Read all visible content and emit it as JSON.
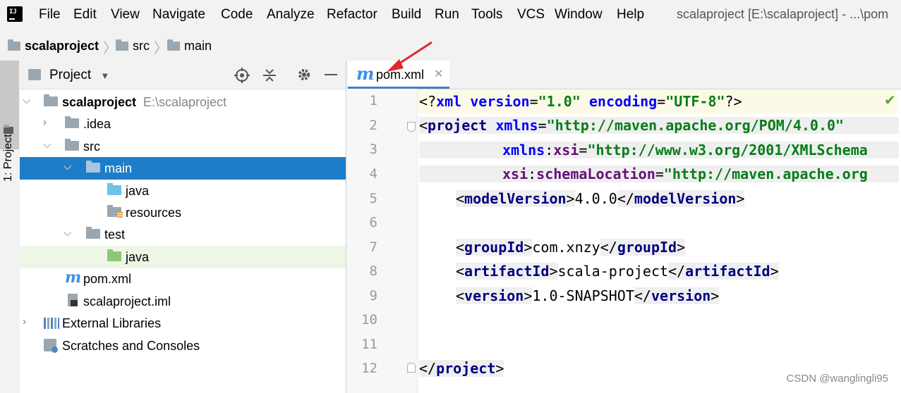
{
  "menu": {
    "items": [
      "File",
      "Edit",
      "View",
      "Navigate",
      "Code",
      "Analyze",
      "Refactor",
      "Build",
      "Run",
      "Tools",
      "VCS",
      "Window",
      "Help"
    ],
    "window_title": "scalaproject [E:\\scalaproject] - ...\\pom"
  },
  "breadcrumb": [
    "scalaproject",
    "src",
    "main"
  ],
  "stripe": {
    "project_label": "1: Project"
  },
  "project_panel": {
    "title": "Project",
    "tree": [
      {
        "label": "scalaproject",
        "path": "E:\\scalaproject",
        "icon": "module-folder-icon",
        "expanded": true
      },
      {
        "label": ".idea",
        "icon": "folder-icon",
        "expanded": false
      },
      {
        "label": "src",
        "icon": "folder-icon",
        "expanded": true
      },
      {
        "label": "main",
        "icon": "folder-icon",
        "expanded": true,
        "selected": true
      },
      {
        "label": "java",
        "icon": "source-root-folder-icon"
      },
      {
        "label": "resources",
        "icon": "resources-folder-icon"
      },
      {
        "label": "test",
        "icon": "folder-icon",
        "expanded": true
      },
      {
        "label": "java",
        "icon": "test-root-folder-icon"
      },
      {
        "label": "pom.xml",
        "icon": "maven-file-icon"
      },
      {
        "label": "scalaproject.iml",
        "icon": "iml-file-icon"
      },
      {
        "label": "External Libraries",
        "icon": "libraries-icon",
        "expanded": false
      },
      {
        "label": "Scratches and Consoles",
        "icon": "scratches-icon"
      }
    ]
  },
  "editor": {
    "tab_label": "pom.xml",
    "line_numbers": [
      "1",
      "2",
      "3",
      "4",
      "5",
      "6",
      "7",
      "8",
      "9",
      "10",
      "11",
      "12"
    ],
    "lines": {
      "l1": {
        "a": "<?",
        "b": "xml ",
        "c": "version",
        "d": "=",
        "e": "\"1.0\"",
        "f": " ",
        "g": "encoding",
        "h": "=",
        "i": "\"UTF-8\"",
        "j": "?>"
      },
      "l2": {
        "a": "<",
        "b": "project ",
        "c": "xmlns",
        "d": "=",
        "e": "\"http://maven.apache.org/POM/4.0.0\""
      },
      "l3": {
        "a": "xmlns",
        "b": ":",
        "c": "xsi",
        "d": "=",
        "e": "\"http://www.w3.org/2001/XMLSchema"
      },
      "l4": {
        "a": "xsi",
        "b": ":",
        "c": "schemaLocation",
        "d": "=",
        "e": "\"http://maven.apache.org"
      },
      "l5": {
        "a": "<",
        "b": "modelVersion",
        "c": ">",
        "d": "4.0.0",
        "e": "</",
        "f": "modelVersion",
        "g": ">"
      },
      "l7": {
        "a": "<",
        "b": "groupId",
        "c": ">",
        "d": "com.xnzy",
        "e": "</",
        "f": "groupId",
        "g": ">"
      },
      "l8": {
        "a": "<",
        "b": "artifactId",
        "c": ">",
        "d": "scala-project",
        "e": "</",
        "f": "artifactId",
        "g": ">"
      },
      "l9": {
        "a": "<",
        "b": "version",
        "c": ">",
        "d": "1.0-SNAPSHOT",
        "e": "</",
        "f": "version",
        "g": ">"
      },
      "l12": {
        "a": "</",
        "b": "project",
        "c": ">"
      }
    }
  },
  "watermark": "CSDN @wanglingli95",
  "colors": {
    "selection": "#1e7dc8",
    "test_row": "#eef7e6",
    "arrow": "#e0282e"
  }
}
